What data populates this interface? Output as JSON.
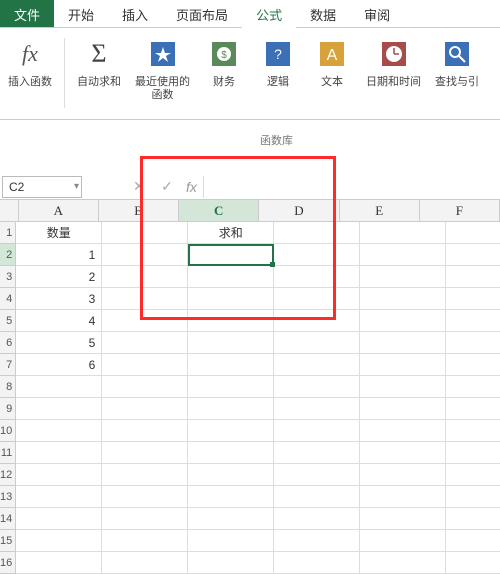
{
  "tabs": {
    "file": "文件",
    "home": "开始",
    "insert": "插入",
    "layout": "页面布局",
    "formulas": "公式",
    "data": "数据",
    "review": "审阅"
  },
  "ribbon": {
    "insert_func": "插入函数",
    "autosum": "自动求和",
    "recent": "最近使用的\n函数",
    "financial": "财务",
    "logical": "逻辑",
    "text": "文本",
    "datetime": "日期和时间",
    "lookup": "查找与引"
  },
  "func_lib": "函数库",
  "namebox": "C2",
  "columns": [
    "A",
    "B",
    "C",
    "D",
    "E",
    "F"
  ],
  "rows": [
    "1",
    "2",
    "3",
    "4",
    "5",
    "6",
    "7",
    "8",
    "9",
    "10",
    "11",
    "12",
    "13",
    "14",
    "15",
    "16"
  ],
  "cells": {
    "A1": "数量",
    "A2": "1",
    "A3": "2",
    "A4": "3",
    "A5": "4",
    "A6": "5",
    "A7": "6",
    "C1": "求和"
  },
  "active_cell": "C2",
  "selected_col": "C",
  "selected_row": "2"
}
